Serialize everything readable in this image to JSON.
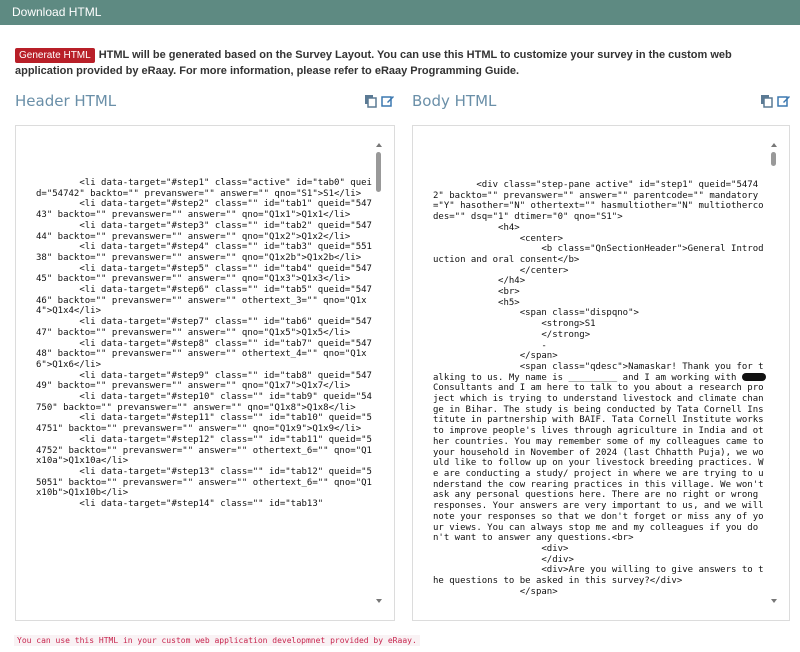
{
  "window": {
    "title": "Download HTML"
  },
  "info": {
    "button_label": "Generate HTML",
    "text": "HTML will be generated based on the Survey Layout. You can use this HTML to customize your survey in the custom web application provided by eRaay. For more information, please refer to eRaay Programming Guide."
  },
  "header_panel": {
    "title": "Header HTML",
    "code": "        <li data-target=\"#step1\" class=\"active\" id=\"tab0\" queid=\"54742\" backto=\"\" prevanswer=\"\" answer=\"\" qno=\"S1\">S1</li>\n        <li data-target=\"#step2\" class=\"\" id=\"tab1\" queid=\"54743\" backto=\"\" prevanswer=\"\" answer=\"\" qno=\"Q1x1\">Q1x1</li>\n        <li data-target=\"#step3\" class=\"\" id=\"tab2\" queid=\"54744\" backto=\"\" prevanswer=\"\" answer=\"\" qno=\"Q1x2\">Q1x2</li>\n        <li data-target=\"#step4\" class=\"\" id=\"tab3\" queid=\"55138\" backto=\"\" prevanswer=\"\" answer=\"\" qno=\"Q1x2b\">Q1x2b</li>\n        <li data-target=\"#step5\" class=\"\" id=\"tab4\" queid=\"54745\" backto=\"\" prevanswer=\"\" answer=\"\" qno=\"Q1x3\">Q1x3</li>\n        <li data-target=\"#step6\" class=\"\" id=\"tab5\" queid=\"54746\" backto=\"\" prevanswer=\"\" answer=\"\" othertext_3=\"\" qno=\"Q1x4\">Q1x4</li>\n        <li data-target=\"#step7\" class=\"\" id=\"tab6\" queid=\"54747\" backto=\"\" prevanswer=\"\" answer=\"\" qno=\"Q1x5\">Q1x5</li>\n        <li data-target=\"#step8\" class=\"\" id=\"tab7\" queid=\"54748\" backto=\"\" prevanswer=\"\" answer=\"\" othertext_4=\"\" qno=\"Q1x6\">Q1x6</li>\n        <li data-target=\"#step9\" class=\"\" id=\"tab8\" queid=\"54749\" backto=\"\" prevanswer=\"\" answer=\"\" qno=\"Q1x7\">Q1x7</li>\n        <li data-target=\"#step10\" class=\"\" id=\"tab9\" queid=\"54750\" backto=\"\" prevanswer=\"\" answer=\"\" qno=\"Q1x8\">Q1x8</li>\n        <li data-target=\"#step11\" class=\"\" id=\"tab10\" queid=\"54751\" backto=\"\" prevanswer=\"\" answer=\"\" qno=\"Q1x9\">Q1x9</li>\n        <li data-target=\"#step12\" class=\"\" id=\"tab11\" queid=\"54752\" backto=\"\" prevanswer=\"\" answer=\"\" othertext_6=\"\" qno=\"Q1x10a\">Q1x10a</li>\n        <li data-target=\"#step13\" class=\"\" id=\"tab12\" queid=\"55051\" backto=\"\" prevanswer=\"\" answer=\"\" othertext_6=\"\" qno=\"Q1x10b\">Q1x10b</li>\n        <li data-target=\"#step14\" class=\"\" id=\"tab13\""
  },
  "body_panel": {
    "title": "Body HTML",
    "code_part1": "        <div class=\"step-pane active\" id=\"step1\" queid=\"54742\" backto=\"\" prevanswer=\"\" answer=\"\" parentcode=\"\" mandatory=\"Y\" hasother=\"N\" othertext=\"\" hasmultiother=\"N\" multiothercodes=\"\" dsq=\"1\" dtimer=\"0\" qno=\"S1\">\n            <h4>\n                <center>\n                    <b class=\"QnSectionHeader\">General Introduction and oral consent</b>\n                </center>\n            </h4>\n            <br>\n            <h5>\n                <span class=\"dispqno\">\n                    <strong>S1\n                    </strong>\n                    -\n                </span>\n                <span class=\"qdesc\">Namaskar! Thank you for talking to us. My name is _________ and I am working with ",
    "code_part2": " Consultants and I am here to talk to you about a research project which is trying to understand livestock and climate change in Bihar. The study is being conducted by Tata Cornell Institute in partnership with BAIF. Tata Cornell Institute works to improve people's lives through agriculture in India and other countries. You may remember some of my colleagues came to your household in November of 2024 (last Chhatth Puja), we would like to follow up on your livestock breeding practices. We are conducting a study/ project in where we are trying to understand the cow rearing practices in this village. We won't ask any personal questions here. There are no right or wrong responses. Your answers are very important to us, and we will note your responses so that we don't forget or miss any of your views. You can always stop me and my colleagues if you don't want to answer any questions.<br>\n                    <div>\n                    </div>\n                    <div>Are you willing to give answers to the questions to be asked in this survey?</div>\n                </span>"
  },
  "footer": {
    "note": "You can use this HTML in your custom web application developmnet provided by eRaay."
  },
  "icons": [
    "copy-icon",
    "edit-icon"
  ]
}
